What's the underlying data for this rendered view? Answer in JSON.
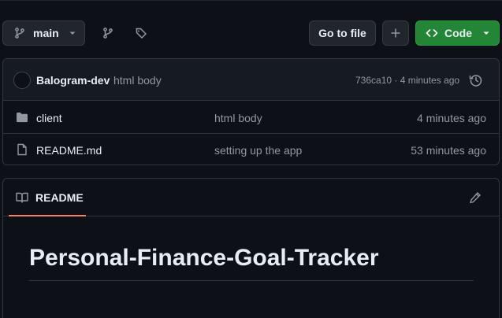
{
  "toolbar": {
    "branch_label": "main",
    "go_to_file_label": "Go to file",
    "code_label": "Code"
  },
  "commit": {
    "author": "Balogram-dev",
    "message": "html body",
    "meta": "736ca10 · 4 minutes ago"
  },
  "files": [
    {
      "name": "client",
      "message": "html body",
      "age": "4 minutes ago",
      "icon": "folder-icon"
    },
    {
      "name": "README.md",
      "message": "setting up the app",
      "age": "53 minutes ago",
      "icon": "file-icon"
    }
  ],
  "readme": {
    "tab_label": "README",
    "title": "Personal-Finance-Goal-Tracker"
  },
  "colors": {
    "background": "#0d1117",
    "accent_green": "#238636",
    "tab_underline": "#f78166",
    "muted_text": "#9198a1"
  }
}
